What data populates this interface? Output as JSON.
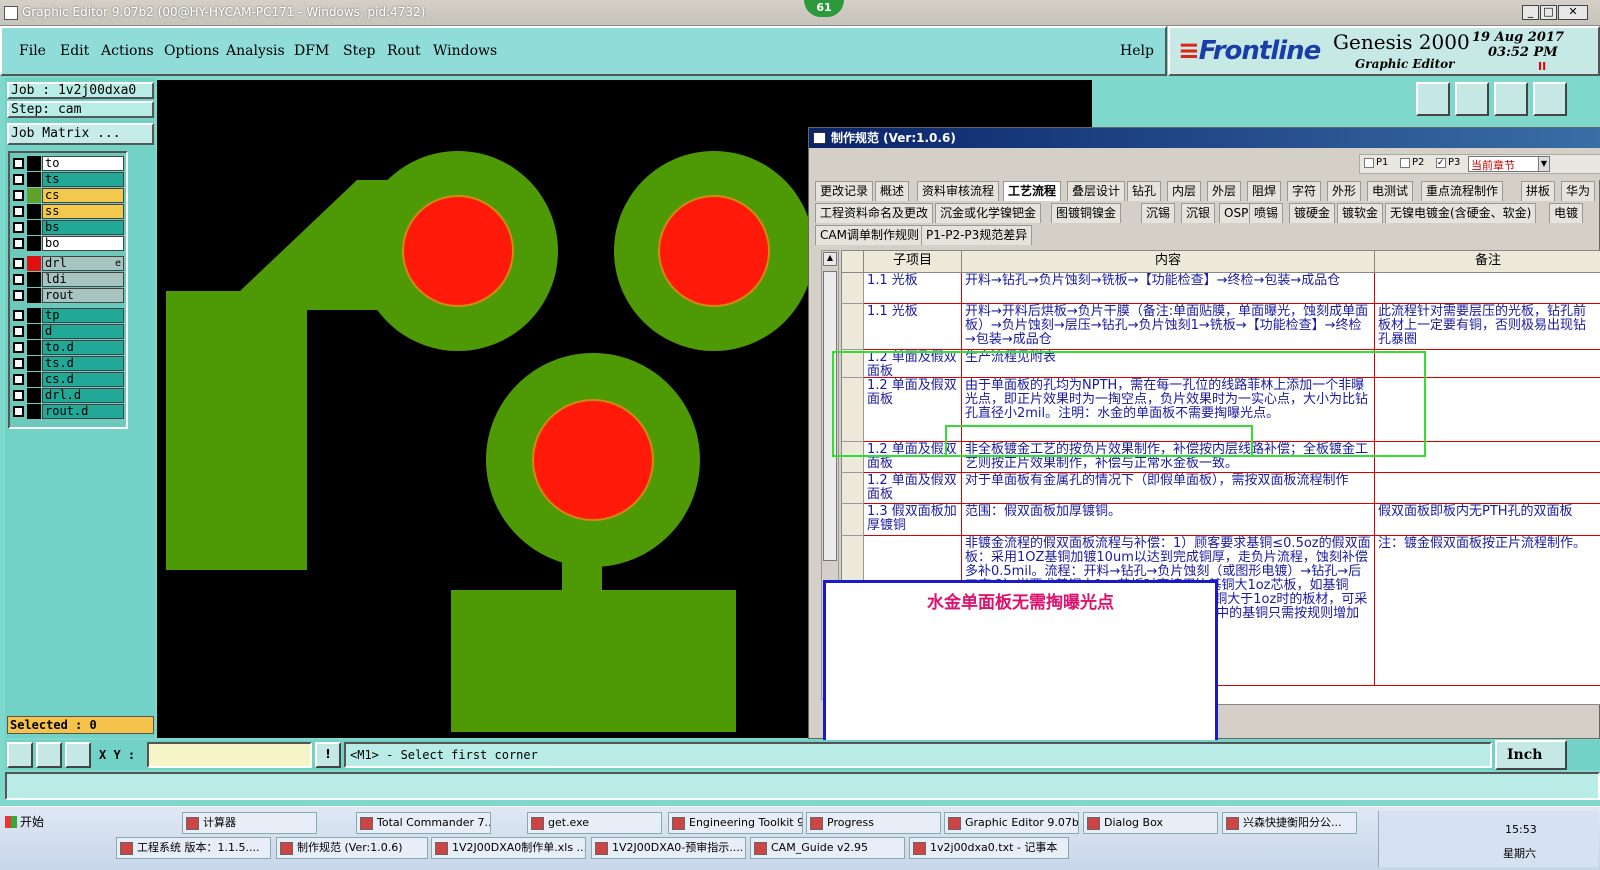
{
  "window": {
    "title": "Graphic Editor 9.07b2 (00@HY-HYCAM-PC171 - Windows, pid:4732)",
    "badge": "61"
  },
  "menu": {
    "items": [
      "File",
      "Edit",
      "Actions",
      "Options",
      "Analysis",
      "DFM",
      "Step",
      "Rout",
      "Windows"
    ],
    "help": "Help"
  },
  "brand": {
    "logo": "Frontline",
    "product": "Genesis 2000",
    "subtitle": "Graphic Editor",
    "date": "19  Aug  2017",
    "time": "03:52  PM",
    "pause": "II"
  },
  "job": {
    "job_label": "Job : 1v2j00dxa0",
    "step_label": "Step: cam",
    "matrix_button": "Job Matrix ..."
  },
  "layers": [
    {
      "name": "to",
      "color": "#ffffff"
    },
    {
      "name": "ts",
      "color": "#22a896"
    },
    {
      "name": "cs",
      "color": "#f2c94c",
      "swatch": "#5fa12a"
    },
    {
      "name": "ss",
      "color": "#f2c94c"
    },
    {
      "name": "bs",
      "color": "#22a896"
    },
    {
      "name": "bo",
      "color": "#ffffff"
    },
    {
      "name": "drl",
      "color": "#a8c4c0",
      "swatch": "#e01010",
      "marker": "e"
    },
    {
      "name": "ldi",
      "color": "#a8c4c0"
    },
    {
      "name": "rout",
      "color": "#a8c4c0"
    },
    {
      "name": "tp",
      "color": "#22a896"
    },
    {
      "name": "d",
      "color": "#22a896"
    },
    {
      "name": "to.d",
      "color": "#22a896"
    },
    {
      "name": "ts.d",
      "color": "#22a896"
    },
    {
      "name": "cs.d",
      "color": "#22a896"
    },
    {
      "name": "drl.d",
      "color": "#22a896"
    },
    {
      "name": "rout.d",
      "color": "#22a896"
    }
  ],
  "selected": "Selected : 0",
  "colors": {
    "copper": "#4e9a06",
    "pad": "#ff1a0a",
    "background": "#000000"
  },
  "dialog": {
    "title": "制作规范 (Ver:1.0.6)",
    "options": {
      "p1": "P1",
      "p2": "P2",
      "p3": "P3",
      "section": "当前章节"
    },
    "tabs_row1": [
      "更改记录",
      "概述",
      "资料审核流程",
      "工艺流程",
      "叠层设计",
      "钻孔",
      "内层",
      "外层",
      "阻焊",
      "字符",
      "外形",
      "电测试",
      "重点流程制作",
      "拼板",
      "华为"
    ],
    "tabs_row2": [
      "工程资料命名及更改",
      "沉金或化学镍钯金",
      "图镀铜镍金",
      "沉锡",
      "沉银",
      "OSP",
      "喷锡",
      "镀硬金",
      "镀软金",
      "无镍电镀金(含硬金、软金)",
      "电镀"
    ],
    "tabs_row3": [
      "CAM调单制作规则",
      "P1-P2-P3规范差异"
    ],
    "headers": {
      "sub": "子项目",
      "content": "内容",
      "note": "备注"
    },
    "rows": [
      {
        "sub": "1.1 光板",
        "content": "开料→钻孔→负片蚀刻→铣板→【功能检查】→终检→包装→成品仓",
        "note": ""
      },
      {
        "sub": "1.1 光板",
        "content": "开料→开料后烘板→负片干膜（备注:单面贴膜，单面曝光，蚀刻成单面板）→负片蚀刻→层压→钻孔→负片蚀刻1→铣板→【功能检查】→终检→包装→成品仓",
        "note": "此流程针对需要层压的光板，钻孔前板材上一定要有铜，否则极易出现钻孔暴圈"
      },
      {
        "sub": "1.2 单面及假双面板",
        "content": "生产流程见附表",
        "note": ""
      },
      {
        "sub": "1.2 单面及假双面板",
        "content": "由于单面板的孔均为NPTH，需在每一孔位的线路菲林上添加一个非曝光点，即正片效果时为一掏空点，负片效果时为一实心点，大小为比钻孔直径小2mil。注明：水金的单面板不需要掏曝光点。",
        "note": ""
      },
      {
        "sub": "1.2 单面及假双面板",
        "content": "非全板镀金工艺的按负片效果制作，补偿按内层线路补偿；全板镀金工艺则按正片效果制作，补偿与正常水金板一致。",
        "note": ""
      },
      {
        "sub": "1.2 单面及假双面板",
        "content": "对于单面板有金属孔的情况下（即假单面板），需按双面板流程制作",
        "note": ""
      },
      {
        "sub": "1.3 假双面板加厚镀铜",
        "content": "范围：假双面板加厚镀铜。",
        "note": "假双面板即板内无PTH孔的双面板"
      },
      {
        "sub": "",
        "content": "非镀金流程的假双面板流程与补偿：1）顾客要求基铜≤0.5oz的假双面板：采用1OZ基铜加镀10um以达到完成铜厚，走负片流程，蚀刻补偿多补0.5mil。流程：开料→钻孔→负片蚀刻（或图形电镀）→钻孔→后工序 2）当要求基铜大1oz芯板时直接用比基铜大1oz芯板，如基铜1oz时，选择2oz基铜→钻孔→后工序 3）基铜大于1oz时的板材，可采用图形电镀方式制作 未能表示出来，制作单中的基铜只需按规则增加加厚",
        "note": "注：镀金假双面板按正片流程制作。"
      }
    ],
    "highlight_note": "注明：水金的单面板不需要掏曝光点。"
  },
  "overlay": {
    "text": "水金单面板无需掏曝光点"
  },
  "command": {
    "coord_label": "X Y :",
    "message": "<M1> - Select first corner",
    "unit": "Inch"
  },
  "taskbar": {
    "start": "开始",
    "row1": [
      "计算器",
      "Total Commander 7....",
      "get.exe",
      "Engineering Toolkit 9....",
      "Progress",
      "Graphic Editor 9.07b...",
      "Dialog Box",
      "兴森快捷衡阳分公..."
    ],
    "row2": [
      "工程系统  版本：1.1.5....",
      "制作规范 (Ver:1.0.6)",
      "1V2J00DXA0制作单.xls ...",
      "1V2J00DXA0-预审指示....",
      "CAM_Guide v2.95",
      "1v2j00dxa0.txt - 记事本"
    ],
    "clock": "15:53",
    "day": "星期六"
  }
}
